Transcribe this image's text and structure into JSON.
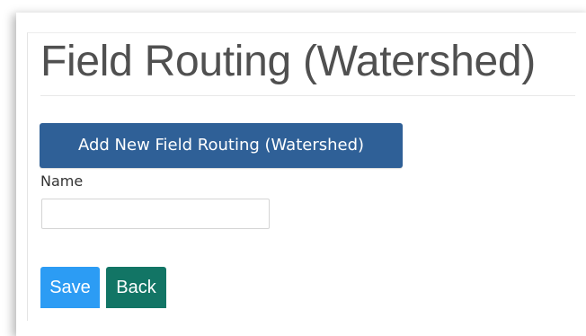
{
  "page": {
    "title": "Field Routing (Watershed)"
  },
  "actions": {
    "add_label": "Add New Field Routing (Watershed)"
  },
  "form": {
    "name_label": "Name",
    "name_value": "",
    "name_placeholder": ""
  },
  "footer": {
    "save_label": "Save",
    "back_label": "Back"
  },
  "colors": {
    "add_button": "#2f6097",
    "save_button": "#2c9cf4",
    "back_button": "#127565",
    "title_text": "#505050"
  }
}
